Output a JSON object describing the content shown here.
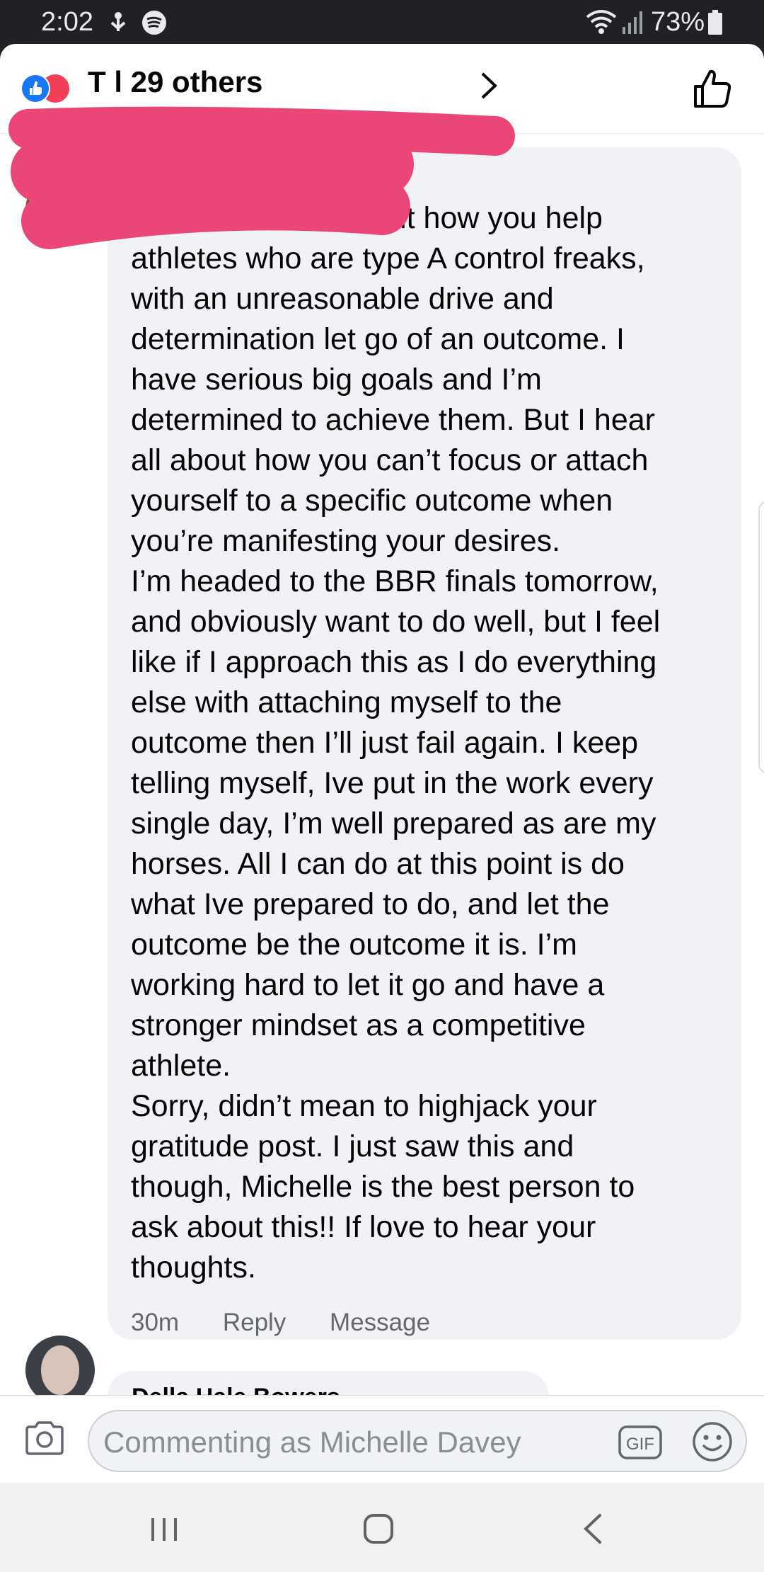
{
  "status_bar": {
    "time": "2:02",
    "battery": "73%",
    "icons": [
      "usb-icon",
      "spotify-icon",
      "wifi-icon",
      "signal-icon",
      "battery-icon"
    ]
  },
  "header": {
    "title": "T                l 29 others",
    "reaction_icons": [
      "like-reaction-icon",
      "love-reaction-icon"
    ],
    "like_icon": "thumbs-up-icon"
  },
  "comment": {
    "author": "",
    "lines": [
      "I’d love to hear about how you help",
      "athletes who are type A control freaks,",
      "with an unreasonable drive and",
      "determination let go of an outcome.  I",
      "have serious big goals and I’m",
      "determined to achieve them.  But I hear",
      "all about how you can’t focus or attach",
      "yourself to a specific outcome when",
      "you’re manifesting your desires.",
      "I’m headed to the BBR finals tomorrow,",
      "and obviously want to do well, but I feel",
      "like if I approach this as I do everything",
      "else with attaching myself to the",
      "outcome then I’ll just fail again.  I keep",
      "telling myself, Ive put in the work every",
      "single day, I’m well prepared as are my",
      "horses.  All I can do at this point is do",
      "what Ive prepared to do, and let the",
      "outcome be the outcome it is.  I’m",
      "working hard to let it go and have a",
      "stronger mindset as a competitive",
      "athlete.",
      "Sorry, didn’t mean to highjack your",
      "gratitude post.  I just saw this and",
      "though, Michelle is the best person to",
      "ask about this!!  If love to hear your",
      "thoughts."
    ],
    "time": "30m",
    "reply_label": "Reply",
    "message_label": "Message"
  },
  "next_comment": {
    "author": "Della Hale Bowers"
  },
  "composer": {
    "placeholder": "Commenting as Michelle Davey",
    "gif_label": "GIF"
  },
  "colors": {
    "bubble": "#f0f2f5",
    "meta_text": "#65676b",
    "redaction": "#ea4778",
    "facebook_blue": "#1877f2"
  }
}
